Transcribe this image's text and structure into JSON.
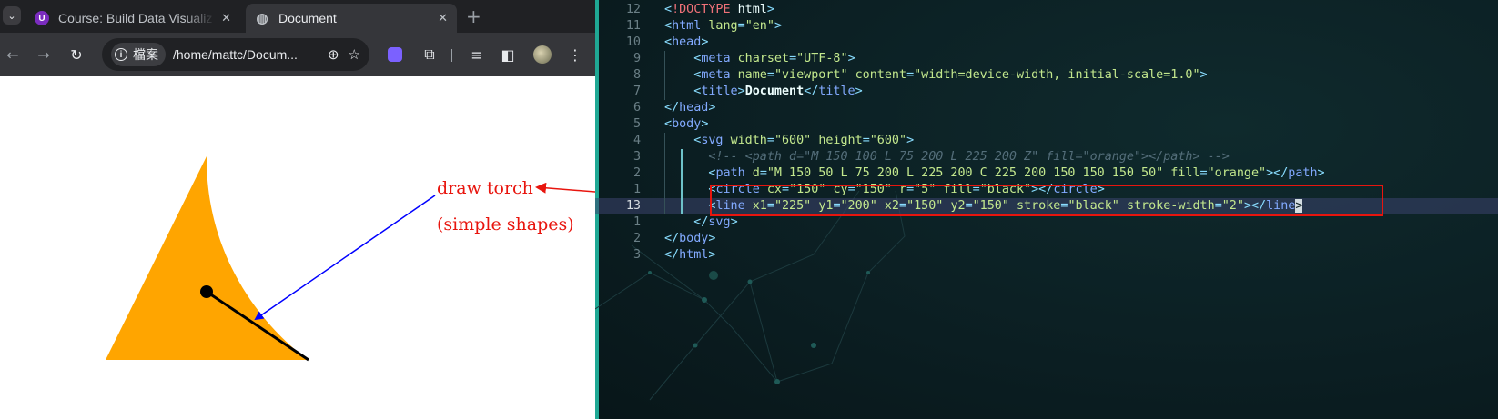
{
  "browser": {
    "tab_list_icon": "chevron-down-icon",
    "tabs": [
      {
        "title": "Course: Build Data Visualiz",
        "favicon": "course-favicon",
        "active": false
      },
      {
        "title": "Document",
        "favicon": "globe-icon",
        "active": true
      }
    ],
    "new_tab_label": "+",
    "toolbar": {
      "site_info_label": "檔案",
      "url": "/home/mattc/Documents/index.html",
      "url_display": "/home/mattc/Docum..."
    }
  },
  "annotation": {
    "line1": "draw torch",
    "line2": "(simple shapes)",
    "color": "#e8150e"
  },
  "drawing": {
    "shape_fill": "#FFA500",
    "dot_fill": "#000000",
    "line_stroke": "#000000",
    "pointer_arrow_color": "#0000ff"
  },
  "editor": {
    "lines": [
      {
        "num": "12",
        "html": "<span class='t-tag'>&lt;</span><span class='t-kw'>!DOCTYPE</span> <span class='t-plain'>html</span><span class='t-tag'>&gt;</span>"
      },
      {
        "num": "11",
        "html": "<span class='t-tag'>&lt;</span><span class='t-tagname'>html</span> <span class='t-attr'>lang</span><span class='t-punc'>=</span><span class='t-str'>\"en\"</span><span class='t-tag'>&gt;</span>"
      },
      {
        "num": "10",
        "html": "<span class='t-tag'>&lt;</span><span class='t-tagname'>head</span><span class='t-tag'>&gt;</span>"
      },
      {
        "num": "9",
        "html": "    <span class='t-tag'>&lt;</span><span class='t-tagname'>meta</span> <span class='t-attr'>charset</span><span class='t-punc'>=</span><span class='t-str'>\"UTF-8\"</span><span class='t-tag'>&gt;</span>"
      },
      {
        "num": "8",
        "html": "    <span class='t-tag'>&lt;</span><span class='t-tagname'>meta</span> <span class='t-attr'>name</span><span class='t-punc'>=</span><span class='t-str'>\"viewport\"</span> <span class='t-attr'>content</span><span class='t-punc'>=</span><span class='t-str'>\"width=device-width, initial-scale=1.0\"</span><span class='t-tag'>&gt;</span>"
      },
      {
        "num": "7",
        "html": "    <span class='t-tag'>&lt;</span><span class='t-tagname'>title</span><span class='t-tag'>&gt;</span><span class='t-bold'>Document</span><span class='t-tag'>&lt;/</span><span class='t-tagname'>title</span><span class='t-tag'>&gt;</span>"
      },
      {
        "num": "6",
        "html": "<span class='t-tag'>&lt;/</span><span class='t-tagname'>head</span><span class='t-tag'>&gt;</span>"
      },
      {
        "num": "5",
        "html": "<span class='t-tag'>&lt;</span><span class='t-tagname'>body</span><span class='t-tag'>&gt;</span>"
      },
      {
        "num": "4",
        "html": "    <span class='t-tag'>&lt;</span><span class='t-tagname'>svg</span> <span class='t-attr'>width</span><span class='t-punc'>=</span><span class='t-str'>\"600\"</span> <span class='t-attr'>height</span><span class='t-punc'>=</span><span class='t-str'>\"600\"</span><span class='t-tag'>&gt;</span>"
      },
      {
        "num": "3",
        "html": "      <span class='t-comment'>&lt;!-- &lt;path d=\"M 150 100 L 75 200 L 225 200 Z\" fill=\"orange\"&gt;&lt;/path&gt; --&gt;</span>"
      },
      {
        "num": "2",
        "html": "      <span class='t-tag'>&lt;</span><span class='t-tagname'>path</span> <span class='t-attr'>d</span><span class='t-punc'>=</span><span class='t-str'>\"M 150 50 L 75 200 L 225 200 C 225 200 150 150 150 50\"</span> <span class='t-attr'>fill</span><span class='t-punc'>=</span><span class='t-str'>\"orange\"</span><span class='t-tag'>&gt;&lt;/</span><span class='t-tagname'>path</span><span class='t-tag'>&gt;</span>"
      },
      {
        "num": "1",
        "html": "      <span class='t-tag'>&lt;</span><span class='t-tagname'>circle</span> <span class='t-attr'>cx</span><span class='t-punc'>=</span><span class='t-str'>\"150\"</span> <span class='t-attr'>cy</span><span class='t-punc'>=</span><span class='t-str'>\"150\"</span> <span class='t-attr'>r</span><span class='t-punc'>=</span><span class='t-str'>\"5\"</span> <span class='t-attr'>fill</span><span class='t-punc'>=</span><span class='t-str'>\"black\"</span><span class='t-tag'>&gt;&lt;/</span><span class='t-tagname'>circle</span><span class='t-tag'>&gt;</span>"
      },
      {
        "num": "13",
        "current": true,
        "html": "      <span class='t-tag'>&lt;</span><span class='t-tagname'>line</span> <span class='t-attr'>x1</span><span class='t-punc'>=</span><span class='t-str'>\"225\"</span> <span class='t-attr'>y1</span><span class='t-punc'>=</span><span class='t-str'>\"200\"</span> <span class='t-attr'>x2</span><span class='t-punc'>=</span><span class='t-str'>\"150\"</span> <span class='t-attr'>y2</span><span class='t-punc'>=</span><span class='t-str'>\"150\"</span> <span class='t-attr'>stroke</span><span class='t-punc'>=</span><span class='t-str'>\"black\"</span> <span class='t-attr'>stroke-width</span><span class='t-punc'>=</span><span class='t-str'>\"2\"</span><span class='t-tag'>&gt;&lt;/</span><span class='t-tagname'>line</span><span class='cursor-box'>&gt;</span>"
      },
      {
        "num": "1",
        "html": "    <span class='t-tag'>&lt;/</span><span class='t-tagname'>svg</span><span class='t-tag'>&gt;</span>"
      },
      {
        "num": "2",
        "html": "<span class='t-tag'>&lt;/</span><span class='t-tagname'>body</span><span class='t-tag'>&gt;</span>"
      },
      {
        "num": "3",
        "html": "<span class='t-tag'>&lt;/</span><span class='t-tagname'>html</span><span class='t-tag'>&gt;</span>"
      }
    ]
  }
}
